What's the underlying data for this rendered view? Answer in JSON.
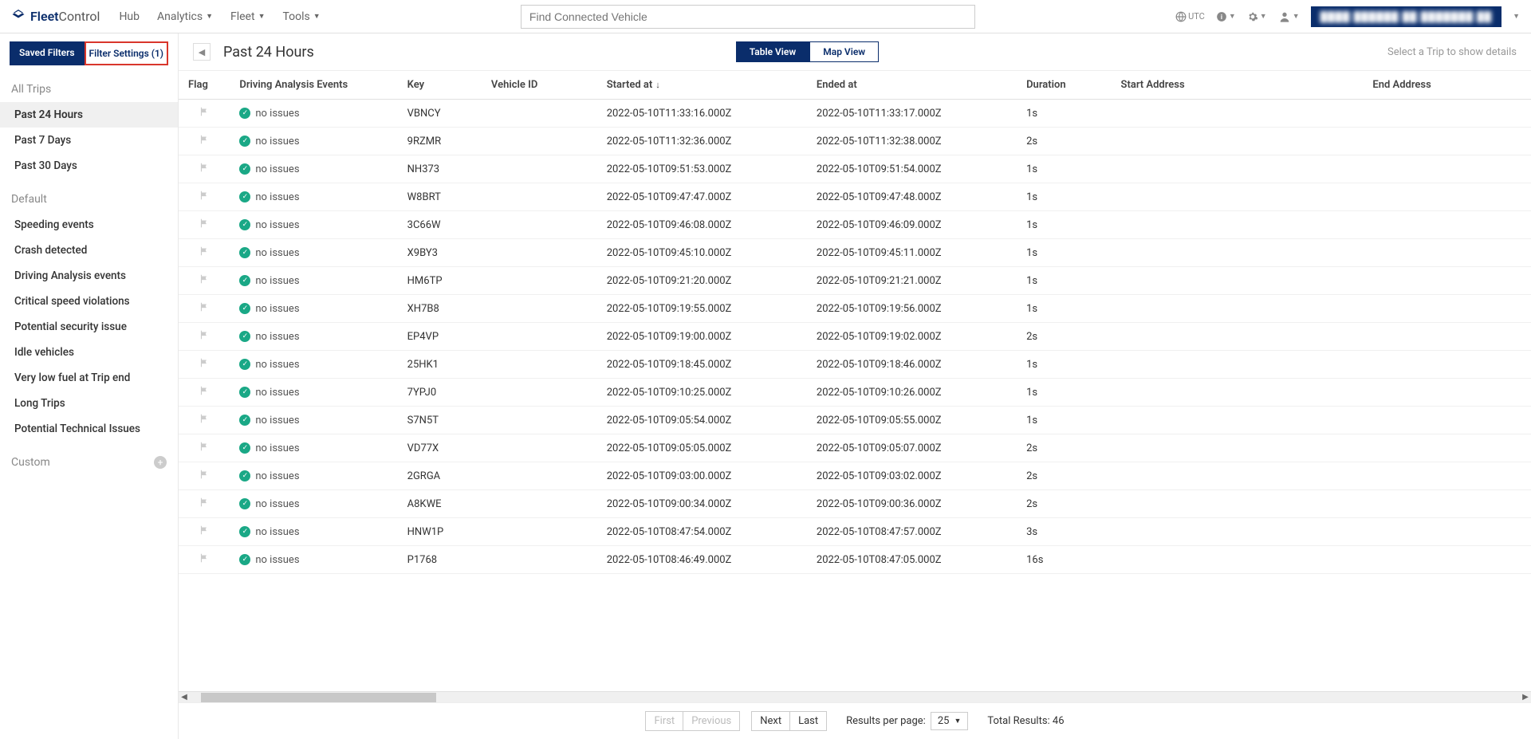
{
  "header": {
    "logo_bold": "Fleet",
    "logo_light": "Control",
    "nav": [
      "Hub",
      "Analytics",
      "Fleet",
      "Tools"
    ],
    "nav_has_caret": [
      false,
      true,
      true,
      true
    ],
    "search_placeholder": "Find Connected Vehicle",
    "tz_label": "UTC"
  },
  "sidebar": {
    "tab_saved": "Saved Filters",
    "tab_settings": "Filter Settings (1)",
    "section_alltrips": "All Trips",
    "alltrips_items": [
      "Past 24 Hours",
      "Past 7 Days",
      "Past 30 Days"
    ],
    "alltrips_active_index": 0,
    "section_default": "Default",
    "default_items": [
      "Speeding events",
      "Crash detected",
      "Driving Analysis events",
      "Critical speed violations",
      "Potential security issue",
      "Idle vehicles",
      "Very low fuel at Trip end",
      "Long Trips",
      "Potential Technical Issues"
    ],
    "section_custom": "Custom"
  },
  "content": {
    "title": "Past 24 Hours",
    "view_table": "Table View",
    "view_map": "Map View",
    "hint": "Select a Trip to show details"
  },
  "table": {
    "columns": [
      "Flag",
      "Driving Analysis Events",
      "Key",
      "Vehicle ID",
      "Started at",
      "Ended at",
      "Duration",
      "Start Address",
      "End Address"
    ],
    "sort_col_index": 4,
    "sort_dir": "down",
    "no_issues_label": "no issues",
    "rows": [
      {
        "key": "VBNCY",
        "started": "2022-05-10T11:33:16.000Z",
        "ended": "2022-05-10T11:33:17.000Z",
        "duration": "1s"
      },
      {
        "key": "9RZMR",
        "started": "2022-05-10T11:32:36.000Z",
        "ended": "2022-05-10T11:32:38.000Z",
        "duration": "2s"
      },
      {
        "key": "NH373",
        "started": "2022-05-10T09:51:53.000Z",
        "ended": "2022-05-10T09:51:54.000Z",
        "duration": "1s"
      },
      {
        "key": "W8BRT",
        "started": "2022-05-10T09:47:47.000Z",
        "ended": "2022-05-10T09:47:48.000Z",
        "duration": "1s"
      },
      {
        "key": "3C66W",
        "started": "2022-05-10T09:46:08.000Z",
        "ended": "2022-05-10T09:46:09.000Z",
        "duration": "1s"
      },
      {
        "key": "X9BY3",
        "started": "2022-05-10T09:45:10.000Z",
        "ended": "2022-05-10T09:45:11.000Z",
        "duration": "1s"
      },
      {
        "key": "HM6TP",
        "started": "2022-05-10T09:21:20.000Z",
        "ended": "2022-05-10T09:21:21.000Z",
        "duration": "1s"
      },
      {
        "key": "XH7B8",
        "started": "2022-05-10T09:19:55.000Z",
        "ended": "2022-05-10T09:19:56.000Z",
        "duration": "1s"
      },
      {
        "key": "EP4VP",
        "started": "2022-05-10T09:19:00.000Z",
        "ended": "2022-05-10T09:19:02.000Z",
        "duration": "2s"
      },
      {
        "key": "25HK1",
        "started": "2022-05-10T09:18:45.000Z",
        "ended": "2022-05-10T09:18:46.000Z",
        "duration": "1s"
      },
      {
        "key": "7YPJ0",
        "started": "2022-05-10T09:10:25.000Z",
        "ended": "2022-05-10T09:10:26.000Z",
        "duration": "1s"
      },
      {
        "key": "S7N5T",
        "started": "2022-05-10T09:05:54.000Z",
        "ended": "2022-05-10T09:05:55.000Z",
        "duration": "1s"
      },
      {
        "key": "VD77X",
        "started": "2022-05-10T09:05:05.000Z",
        "ended": "2022-05-10T09:05:07.000Z",
        "duration": "2s"
      },
      {
        "key": "2GRGA",
        "started": "2022-05-10T09:03:00.000Z",
        "ended": "2022-05-10T09:03:02.000Z",
        "duration": "2s"
      },
      {
        "key": "A8KWE",
        "started": "2022-05-10T09:00:34.000Z",
        "ended": "2022-05-10T09:00:36.000Z",
        "duration": "2s"
      },
      {
        "key": "HNW1P",
        "started": "2022-05-10T08:47:54.000Z",
        "ended": "2022-05-10T08:47:57.000Z",
        "duration": "3s"
      },
      {
        "key": "P1768",
        "started": "2022-05-10T08:46:49.000Z",
        "ended": "2022-05-10T08:47:05.000Z",
        "duration": "16s"
      }
    ]
  },
  "pagination": {
    "first": "First",
    "prev": "Previous",
    "next": "Next",
    "last": "Last",
    "rpp_label": "Results per page:",
    "rpp_value": "25",
    "total_label": "Total Results: 46"
  }
}
